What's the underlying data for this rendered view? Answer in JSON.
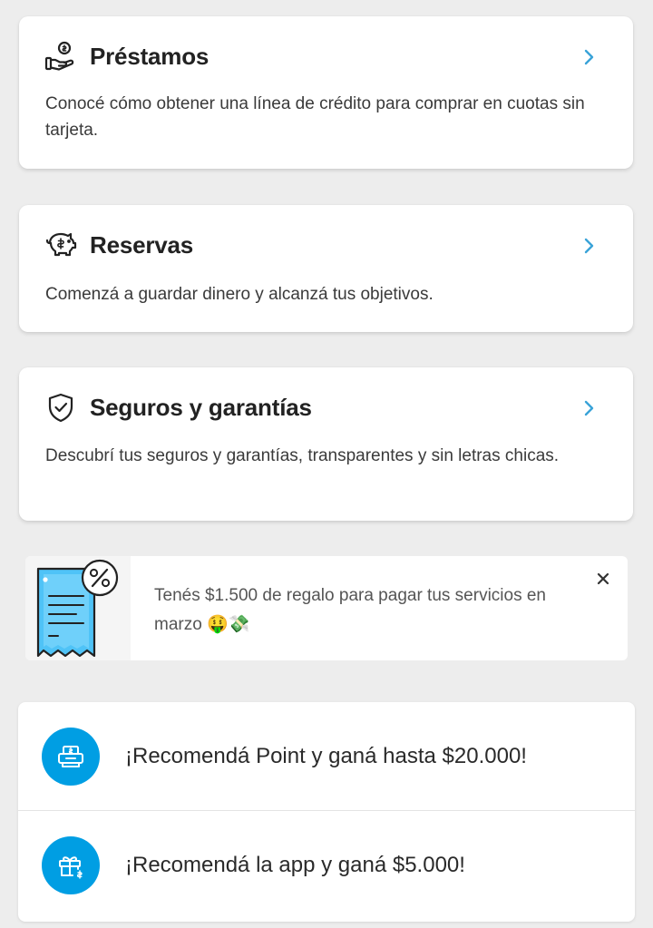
{
  "cards": [
    {
      "title": "Préstamos",
      "description": "Conocé cómo obtener una línea de crédito para comprar en cuotas sin tarjeta.",
      "icon": "hand-coin-icon"
    },
    {
      "title": "Reservas",
      "description": "Comenzá a guardar dinero y alcanzá tus objetivos.",
      "icon": "piggy-bank-icon"
    },
    {
      "title": "Seguros y garantías",
      "description": "Descubrí tus seguros y garantías, transparentes y sin letras chicas.",
      "icon": "shield-check-icon"
    }
  ],
  "promo": {
    "text": "Tenés $1.500 de regalo para pagar tus servicios en marzo 🤑💸",
    "icon": "receipt-discount-illustration",
    "close_icon": "close-icon"
  },
  "refer": {
    "items": [
      {
        "label": "¡Recomendá Point y ganá hasta $20.000!",
        "icon": "point-device-icon"
      },
      {
        "label": "¡Recomendá la app y ganá $5.000!",
        "icon": "gift-icon"
      }
    ]
  },
  "colors": {
    "accent": "#009ee3",
    "chevron": "#3aa3d8",
    "background": "#ededed",
    "illustration_blue": "#4fc3f7"
  }
}
